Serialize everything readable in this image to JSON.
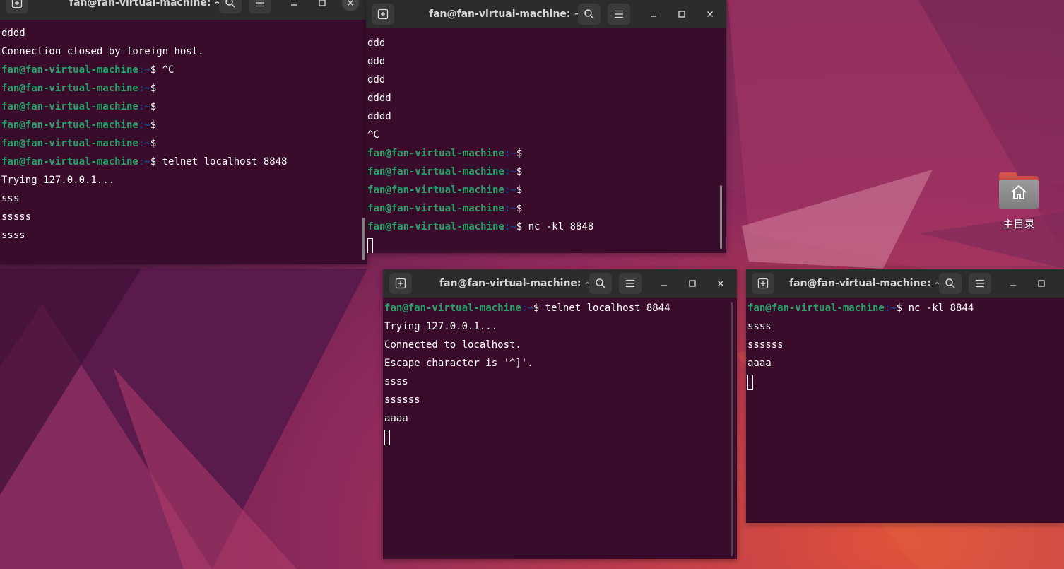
{
  "desktop": {
    "icon_label": "主目录",
    "icon": "home-folder-icon"
  },
  "terminals": [
    {
      "title": "fan@fan-virtual-machine: ~",
      "lines": [
        {
          "text": "dddd"
        },
        {
          "text": "Connection closed by foreign host."
        },
        {
          "user": "fan@fan-virtual-machine",
          "path": ":~",
          "cmd": "$ ^C"
        },
        {
          "user": "fan@fan-virtual-machine",
          "path": ":~",
          "cmd": "$"
        },
        {
          "user": "fan@fan-virtual-machine",
          "path": ":~",
          "cmd": "$"
        },
        {
          "user": "fan@fan-virtual-machine",
          "path": ":~",
          "cmd": "$"
        },
        {
          "user": "fan@fan-virtual-machine",
          "path": ":~",
          "cmd": "$"
        },
        {
          "user": "fan@fan-virtual-machine",
          "path": ":~",
          "cmd": "$ telnet localhost 8848"
        },
        {
          "text": "Trying 127.0.0.1..."
        },
        {
          "text": "sss"
        },
        {
          "text": "sssss"
        },
        {
          "text": "ssss"
        }
      ]
    },
    {
      "title": "fan@fan-virtual-machine: ~",
      "lines": [
        {
          "text": "ddd"
        },
        {
          "text": "ddd"
        },
        {
          "text": "ddd"
        },
        {
          "text": "dddd"
        },
        {
          "text": "dddd"
        },
        {
          "text": "^C"
        },
        {
          "user": "fan@fan-virtual-machine",
          "path": ":~",
          "cmd": "$"
        },
        {
          "user": "fan@fan-virtual-machine",
          "path": ":~",
          "cmd": "$"
        },
        {
          "user": "fan@fan-virtual-machine",
          "path": ":~",
          "cmd": "$"
        },
        {
          "user": "fan@fan-virtual-machine",
          "path": ":~",
          "cmd": "$"
        },
        {
          "user": "fan@fan-virtual-machine",
          "path": ":~",
          "cmd": "$ nc -kl 8848"
        }
      ]
    },
    {
      "title": "fan@fan-virtual-machine: ~",
      "lines": [
        {
          "user": "fan@fan-virtual-machine",
          "path": ":~",
          "cmd": "$ telnet localhost 8844"
        },
        {
          "text": "Trying 127.0.0.1..."
        },
        {
          "text": "Connected to localhost."
        },
        {
          "text": "Escape character is '^]'."
        },
        {
          "text": "ssss"
        },
        {
          "text": "ssssss"
        },
        {
          "text": "aaaa"
        }
      ]
    },
    {
      "title": "fan@fan-virtual-machine: ~",
      "lines": [
        {
          "user": "fan@fan-virtual-machine",
          "path": ":~",
          "cmd": "$ nc -kl 8844"
        },
        {
          "text": "ssss"
        },
        {
          "text": "ssssss"
        },
        {
          "text": "aaaa"
        }
      ]
    }
  ]
}
